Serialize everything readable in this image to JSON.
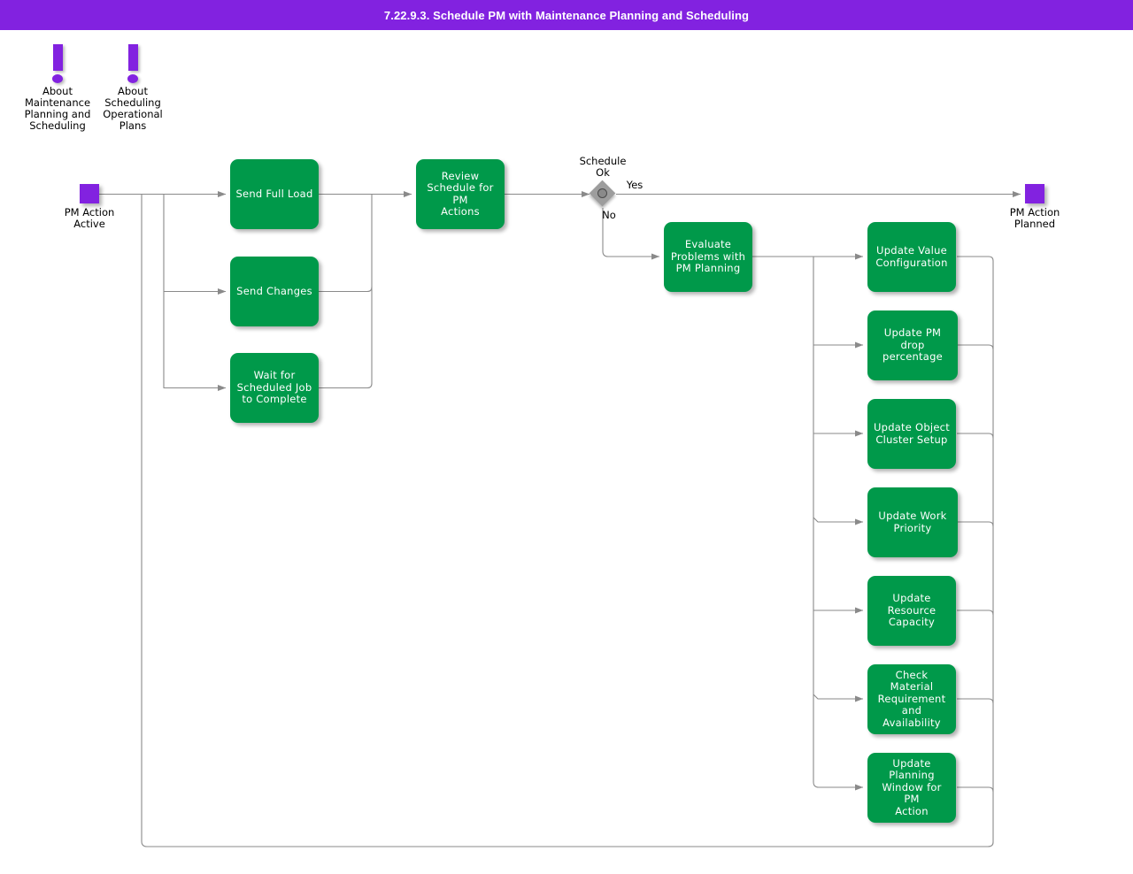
{
  "header": {
    "title": "7.22.9.3. Schedule PM with Maintenance Planning and Scheduling"
  },
  "colors": {
    "header_purple": "#8222e0",
    "process_green": "#00994a",
    "terminal_purple": "#8222e0",
    "decision_gray": "#9d9d9d",
    "edge_gray": "#808080",
    "text_white": "#ffffff",
    "text_black": "#000000"
  },
  "notes": [
    {
      "id": "note-maintenance-planning",
      "label": "About\nMaintenance\nPlanning and\nScheduling",
      "icon": "exclamation-icon"
    },
    {
      "id": "note-scheduling-plans",
      "label": "About\nScheduling\nOperational\nPlans",
      "icon": "exclamation-icon"
    }
  ],
  "terminals": [
    {
      "id": "start",
      "label": "PM Action\nActive"
    },
    {
      "id": "end",
      "label": "PM Action\nPlanned"
    }
  ],
  "decision": {
    "id": "schedule-ok",
    "label": "Schedule\nOk",
    "branch_yes": "Yes",
    "branch_no": "No"
  },
  "processes": {
    "left_column": [
      {
        "id": "send-full-load",
        "label": "Send Full Load"
      },
      {
        "id": "send-changes",
        "label": "Send Changes"
      },
      {
        "id": "wait-for-scheduled-job",
        "label": "Wait for\nScheduled Job\nto Complete"
      }
    ],
    "review": {
      "id": "review-schedule",
      "label": "Review\nSchedule for PM\nActions"
    },
    "evaluate": {
      "id": "evaluate-problems",
      "label": "Evaluate\nProblems with\nPM Planning"
    },
    "right_column": [
      {
        "id": "update-value-configuration",
        "label": "Update Value\nConfiguration"
      },
      {
        "id": "update-pm-drop-percentage",
        "label": "Update PM drop\npercentage"
      },
      {
        "id": "update-object-cluster-setup",
        "label": "Update Object\nCluster Setup"
      },
      {
        "id": "update-work-priority",
        "label": "Update Work\nPriority"
      },
      {
        "id": "update-resource-capacity",
        "label": "Update\nResource\nCapacity"
      },
      {
        "id": "check-material-requirement",
        "label": "Check Material\nRequirement\nand Availability"
      },
      {
        "id": "update-planning-window",
        "label": "Update Planning\nWindow for PM\nAction"
      }
    ]
  }
}
